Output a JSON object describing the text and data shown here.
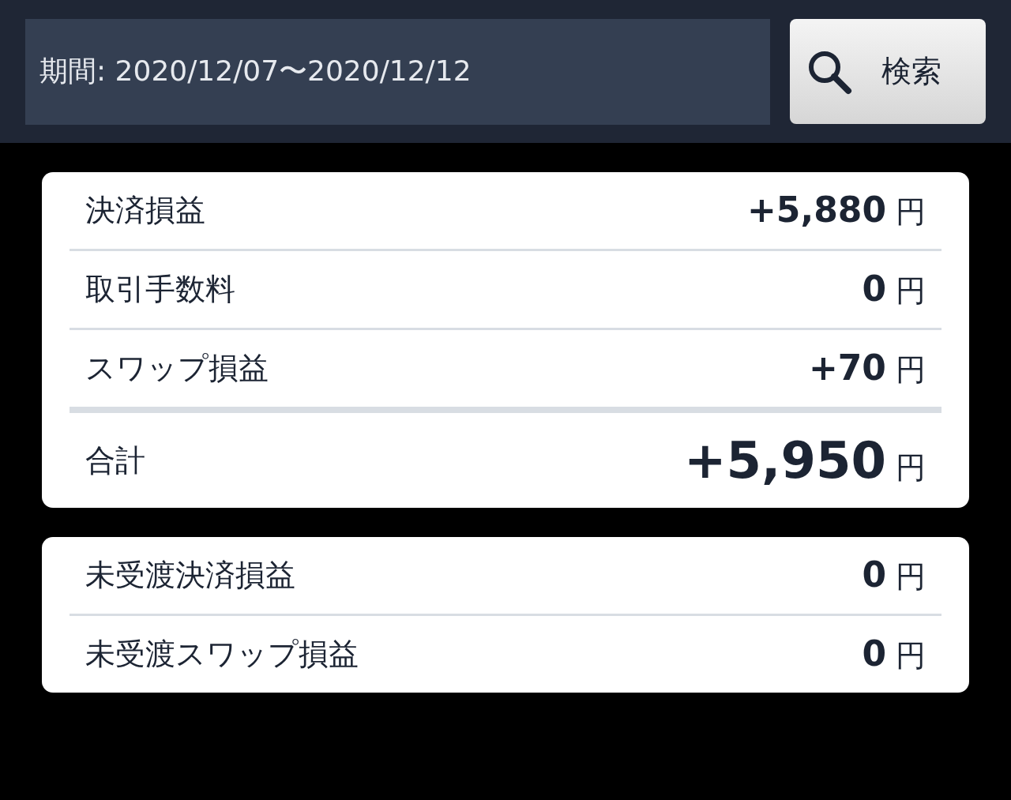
{
  "search_bar": {
    "period": "期間: 2020/12/07〜2020/12/12",
    "button": "検索"
  },
  "summary": {
    "rows": [
      {
        "kind": "item",
        "label": "決済損益",
        "value": "+5,880",
        "unit": "円"
      },
      {
        "kind": "item",
        "label": "取引手数料",
        "value": "0",
        "unit": "円"
      },
      {
        "kind": "item",
        "label": "スワップ損益",
        "value": "+70",
        "unit": "円"
      },
      {
        "kind": "total",
        "label": "合計",
        "value": "+5,950",
        "unit": "円"
      }
    ]
  },
  "unsettled": {
    "rows": [
      {
        "label": "未受渡決済損益",
        "value": "0",
        "unit": "円"
      },
      {
        "label": "未受渡スワップ損益",
        "value": "0",
        "unit": "円"
      }
    ]
  }
}
